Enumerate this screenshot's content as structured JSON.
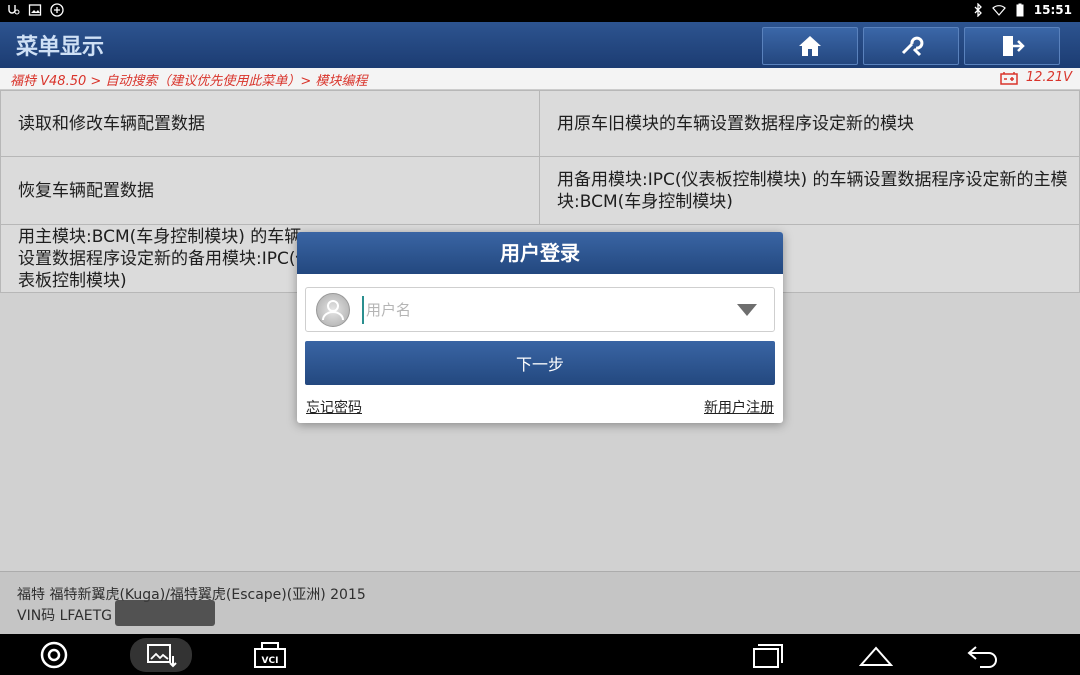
{
  "statusbar": {
    "time": "15:51"
  },
  "header": {
    "title": "菜单显示"
  },
  "breadcrumb": {
    "path": "福特 V48.50 > 自动搜索（建议优先使用此菜单）> 模块编程",
    "voltage": "12.21V"
  },
  "menu": {
    "items": [
      {
        "label": "读取和修改车辆配置数据"
      },
      {
        "label": "用原车旧模块的车辆设置数据程序设定新的模块"
      },
      {
        "label": "恢复车辆配置数据"
      },
      {
        "label": "用备用模块:IPC(仪表板控制模块) 的车辆设置数据程序设定新的主模块:BCM(车身控制模块)"
      },
      {
        "label": "用主模块:BCM(车身控制模块) 的车辆设置数据程序设定新的备用模块:IPC(仪表板控制模块)"
      }
    ]
  },
  "vehicle": {
    "line1": "福特 福特新翼虎(Kuga)/福特翼虎(Escape)(亚洲) 2015",
    "line2": "VIN码 LFAETG"
  },
  "dialog": {
    "title": "用户登录",
    "username_placeholder": "用户名",
    "next_label": "下一步",
    "forgot_label": "忘记密码",
    "register_label": "新用户注册"
  },
  "icons": {
    "home": "home-icon",
    "diagnose": "wrench-icon",
    "exit": "exit-icon"
  },
  "colors": {
    "header_blue": "#23487f",
    "breadcrumb_red": "#d9342b"
  }
}
